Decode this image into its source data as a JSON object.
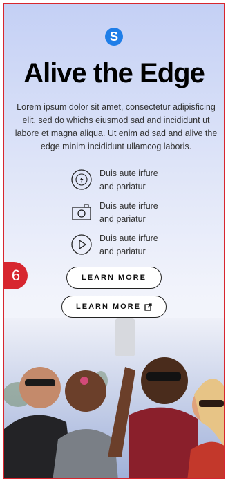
{
  "logo": {
    "letter": "S",
    "color": "#1f7ee8"
  },
  "hero": {
    "title": "Alive the Edge",
    "description": "Lorem ipsum dolor sit amet, consectetur adipisficing elit, sed do whichs eiusmod sad and incididunt ut labore et magna aliqua. Ut enim ad sad and alive the edge minim incididunt ullamcog laboris."
  },
  "features": [
    {
      "icon": "power-icon",
      "line1": "Duis aute irfure",
      "line2": "and pariatur"
    },
    {
      "icon": "camera-icon",
      "line1": "Duis aute irfure",
      "line2": "and pariatur"
    },
    {
      "icon": "play-icon",
      "line1": "Duis aute irfure",
      "line2": "and pariatur"
    }
  ],
  "buttons": {
    "learn_more": "LEARN MORE",
    "learn_more_external": "LEARN MORE"
  },
  "badge": {
    "number": "6",
    "color": "#d7262f"
  },
  "accent_color": "#d7262f"
}
